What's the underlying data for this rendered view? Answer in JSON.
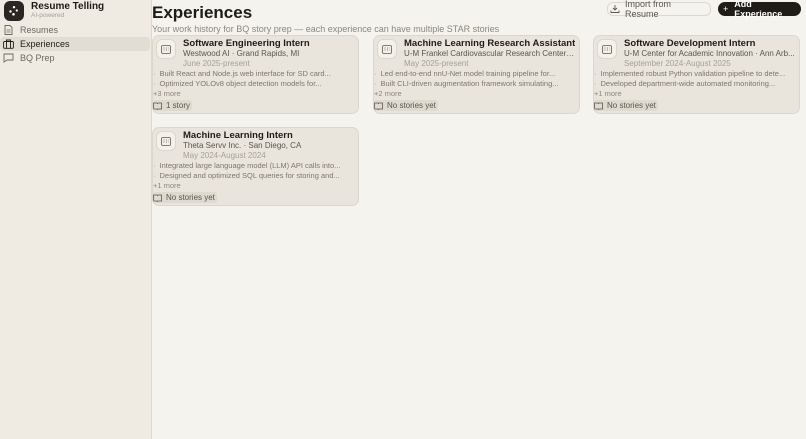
{
  "app": {
    "name": "Resume Telling",
    "tagline": "AI-powered"
  },
  "sidebar": {
    "items": [
      {
        "label": "Resumes",
        "icon": "document-icon",
        "active": false
      },
      {
        "label": "Experiences",
        "icon": "briefcase-icon",
        "active": true
      },
      {
        "label": "BQ Prep",
        "icon": "chat-icon",
        "active": false
      }
    ]
  },
  "header": {
    "title": "Experiences",
    "subtitle": "Your work history for BQ story prep — each experience can have multiple STAR stories",
    "import_label": "Import from Resume",
    "add_label": "Add Experience"
  },
  "experiences": [
    {
      "title": "Software Engineering Intern",
      "org": "Westwood AI · Grand Rapids, MI",
      "dates": "June 2025-present",
      "bullets": [
        "Built React and Node.js web interface for SD card...",
        "Optimized YOLOv8 object detection models for..."
      ],
      "more": "+3 more",
      "stories": "1 story"
    },
    {
      "title": "Machine Learning Research Assistant",
      "org": "U-M Frankel Cardiovascular Research Center · ...",
      "dates": "May 2025-present",
      "bullets": [
        "Led end-to-end nnU-Net model training pipeline for...",
        "Built CLI-driven augmentation framework simulating..."
      ],
      "more": "+2 more",
      "stories": "No stories yet"
    },
    {
      "title": "Software Development Intern",
      "org": "U-M Center for Academic Innovation · Ann Arb...",
      "dates": "September 2024-August 2025",
      "bullets": [
        "Implemented robust Python validation pipeline to dete...",
        "Developed department-wide automated monitoring..."
      ],
      "more": "+1 more",
      "stories": "No stories yet"
    },
    {
      "title": "Machine Learning Intern",
      "org": "Theta Servv Inc. · San Diego, CA",
      "dates": "May 2024-August 2024",
      "bullets": [
        "Integrated large language model (LLM) API calls into...",
        "Designed and optimized SQL queries for storing and..."
      ],
      "more": "+1 more",
      "stories": "No stories yet"
    }
  ]
}
